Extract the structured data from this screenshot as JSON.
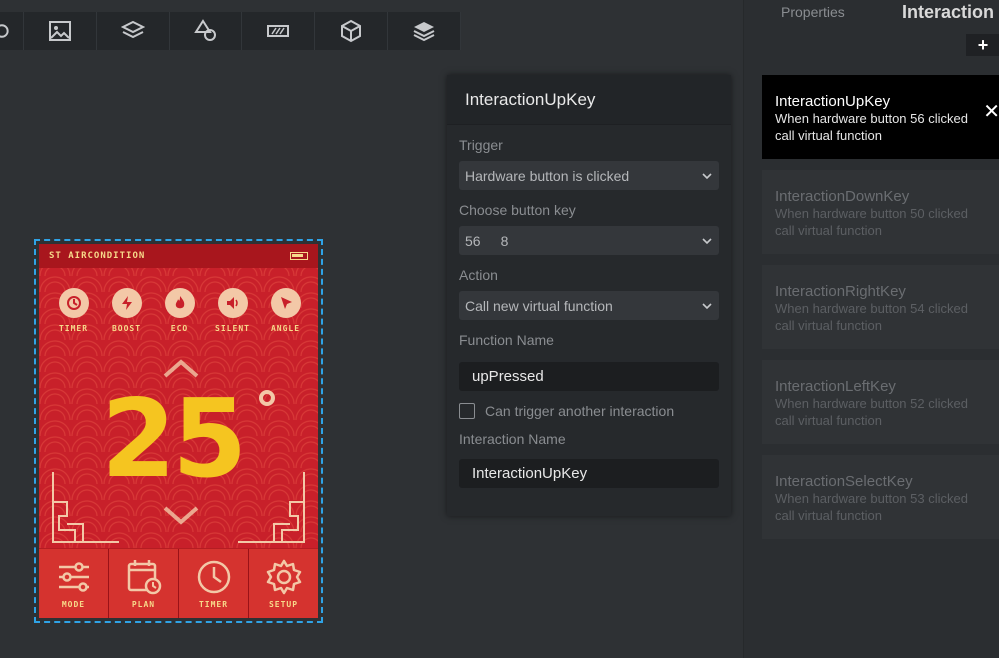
{
  "toolbar": {
    "icons": [
      "partial-icon",
      "image-icon",
      "layers-icon",
      "shapes-icon",
      "ruler-icon",
      "cube-icon",
      "stack-icon"
    ]
  },
  "device": {
    "title": "ST AIRCONDITION",
    "modes": [
      {
        "label": "TIMER",
        "icon": "clock-icon"
      },
      {
        "label": "BOOST",
        "icon": "bolt-icon"
      },
      {
        "label": "ECO",
        "icon": "flame-icon"
      },
      {
        "label": "SILENT",
        "icon": "speaker-icon"
      },
      {
        "label": "ANGLE",
        "icon": "cursor-icon"
      }
    ],
    "temperature": "25",
    "footer": [
      {
        "label": "MODE",
        "icon": "sliders-icon"
      },
      {
        "label": "PLAN",
        "icon": "calendar-clock-icon"
      },
      {
        "label": "TIMER",
        "icon": "clock-icon"
      },
      {
        "label": "SETUP",
        "icon": "gear-icon"
      }
    ]
  },
  "editor": {
    "title": "InteractionUpKey",
    "trigger_label": "Trigger",
    "trigger_value": "Hardware button is clicked",
    "button_key_label": "Choose button key",
    "button_key_value_a": "56",
    "button_key_value_b": "8",
    "action_label": "Action",
    "action_value": "Call new virtual function",
    "function_name_label": "Function Name",
    "function_name_value": "upPressed",
    "can_trigger_label": "Can trigger another interaction",
    "interaction_name_label": "Interaction Name",
    "interaction_name_value": "InteractionUpKey"
  },
  "side": {
    "tab_properties": "Properties",
    "tab_interactions": "Interaction",
    "add_label": "+",
    "cards": [
      {
        "title": "InteractionUpKey",
        "line1": "When hardware button 56 clicked",
        "line2": "call virtual function",
        "active": true
      },
      {
        "title": "InteractionDownKey",
        "line1": "When hardware button 50 clicked",
        "line2": "call virtual function",
        "active": false
      },
      {
        "title": "InteractionRightKey",
        "line1": "When hardware button 54 clicked",
        "line2": "call virtual function",
        "active": false
      },
      {
        "title": "InteractionLeftKey",
        "line1": "When hardware button 52 clicked",
        "line2": "call virtual function",
        "active": false
      },
      {
        "title": "InteractionSelectKey",
        "line1": "When hardware button 53 clicked",
        "line2": "call virtual function",
        "active": false
      }
    ],
    "close_symbol": "✕"
  }
}
